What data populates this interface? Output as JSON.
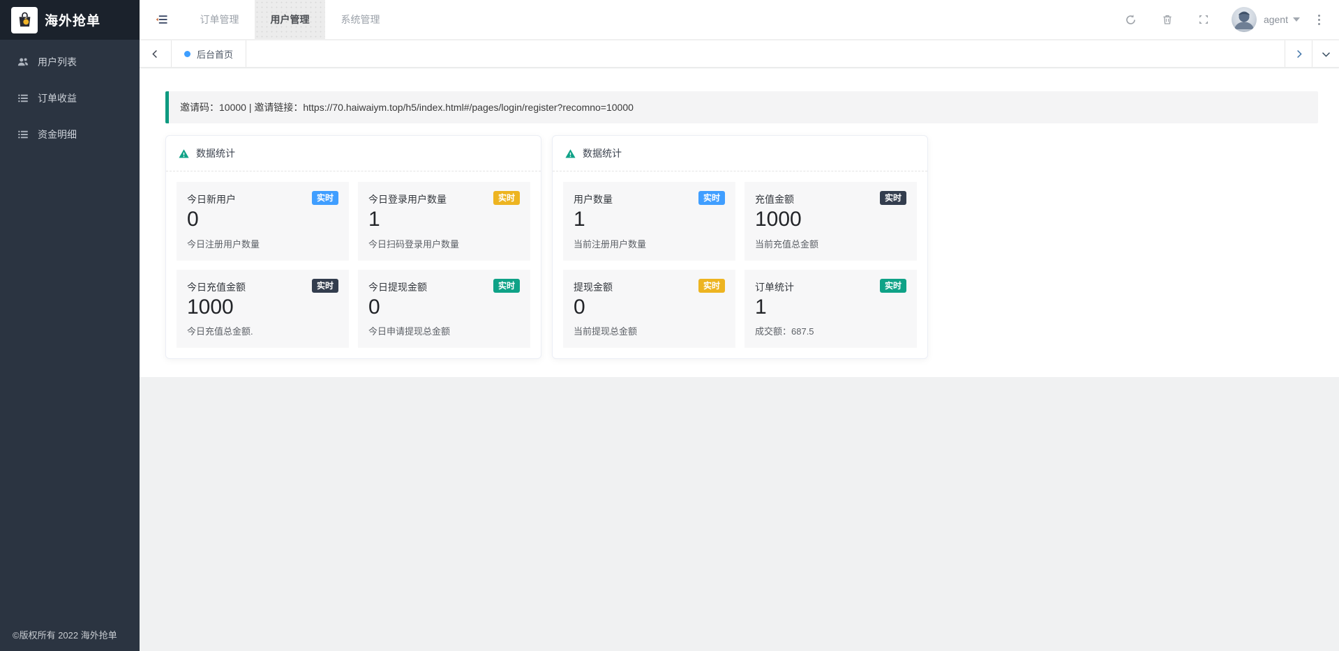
{
  "app": {
    "brand": "海外抢单",
    "copyright": "©版权所有 2022 海外抢单"
  },
  "sidebar": {
    "items": [
      {
        "label": "用户列表",
        "icon": "users-icon"
      },
      {
        "label": "订单收益",
        "icon": "list-icon"
      },
      {
        "label": "资金明细",
        "icon": "list-icon"
      }
    ]
  },
  "navbar": {
    "tabs": [
      {
        "label": "订单管理",
        "active": false
      },
      {
        "label": "用户管理",
        "active": true
      },
      {
        "label": "系统管理",
        "active": false
      }
    ],
    "icons": [
      "refresh-icon",
      "trash-icon",
      "fullscreen-icon"
    ],
    "user": {
      "name": "agent"
    }
  },
  "tabbar": {
    "open_tab": {
      "label": "后台首页",
      "dot_color": "#3D9EFF"
    }
  },
  "invite": {
    "text": "邀请码：10000 | 邀请链接：https://70.haiwaiym.top/h5/index.html#/pages/login/register?recomno=10000"
  },
  "cards": [
    {
      "title": "数据统计",
      "tiles": [
        {
          "label": "今日新用户",
          "badge": "实时",
          "badge_color": "#409EFF",
          "value": "0",
          "sub": "今日注册用户数量"
        },
        {
          "label": "今日登录用户数量",
          "badge": "实时",
          "badge_color": "#EDB421",
          "value": "1",
          "sub": "今日扫码登录用户数量"
        },
        {
          "label": "今日充值金额",
          "badge": "实时",
          "badge_color": "#333D4E",
          "value": "1000",
          "sub": "今日充值总金额."
        },
        {
          "label": "今日提现金额",
          "badge": "实时",
          "badge_color": "#0FA287",
          "value": "0",
          "sub": "今日申请提现总金额"
        }
      ]
    },
    {
      "title": "数据统计",
      "tiles": [
        {
          "label": "用户数量",
          "badge": "实时",
          "badge_color": "#409EFF",
          "value": "1",
          "sub": "当前注册用户数量"
        },
        {
          "label": "充值金额",
          "badge": "实时",
          "badge_color": "#333D4E",
          "value": "1000",
          "sub": "当前充值总金额"
        },
        {
          "label": "提现金额",
          "badge": "实时",
          "badge_color": "#EDB421",
          "value": "0",
          "sub": "当前提现总金额"
        },
        {
          "label": "订单统计",
          "badge": "实时",
          "badge_color": "#0FA287",
          "value": "1",
          "sub": "成交额：687.5"
        }
      ]
    }
  ],
  "colors": {
    "sidebar_bg": "#2b3441",
    "logo_bg": "#1b222c",
    "accent_teal": "#0E9A80",
    "page_bg": "#f0f1f2"
  }
}
